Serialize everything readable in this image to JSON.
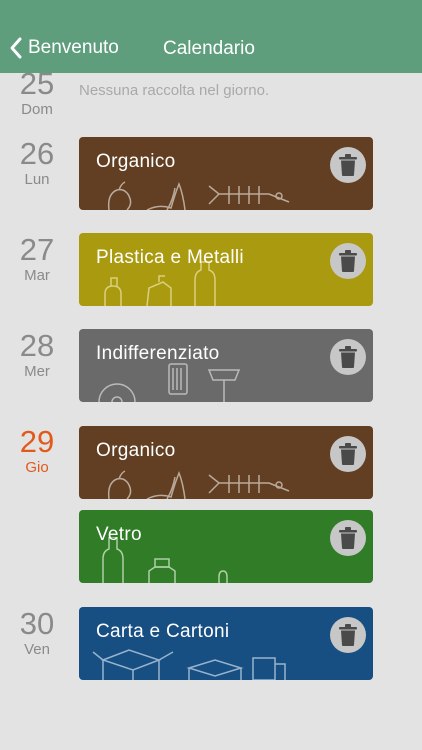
{
  "header": {
    "back_label": "Benvenuto",
    "title": "Calendario"
  },
  "days": [
    {
      "num": "25",
      "weekday": "Dom",
      "empty_text": "Nessuna raccolta nel giorno."
    },
    {
      "num": "26",
      "weekday": "Lun",
      "collections": [
        {
          "label": "Organico",
          "color": "#623f22",
          "icon": "trash-icon"
        }
      ]
    },
    {
      "num": "27",
      "weekday": "Mar",
      "collections": [
        {
          "label": "Plastica e Metalli",
          "color": "#aa9a0f",
          "icon": "trash-icon"
        }
      ]
    },
    {
      "num": "28",
      "weekday": "Mer",
      "collections": [
        {
          "label": "Indifferenziato",
          "color": "#6a6a6a",
          "icon": "trash-icon"
        }
      ]
    },
    {
      "num": "29",
      "weekday": "Gio",
      "today": true,
      "today_color": "#e05a1c",
      "collections": [
        {
          "label": "Organico",
          "color": "#623f22",
          "icon": "trash-icon"
        },
        {
          "label": "Vetro",
          "color": "#307c27",
          "icon": "trash-icon"
        }
      ]
    },
    {
      "num": "30",
      "weekday": "Ven",
      "collections": [
        {
          "label": "Carta e Cartoni",
          "color": "#174f82",
          "icon": "trash-icon"
        }
      ]
    }
  ]
}
